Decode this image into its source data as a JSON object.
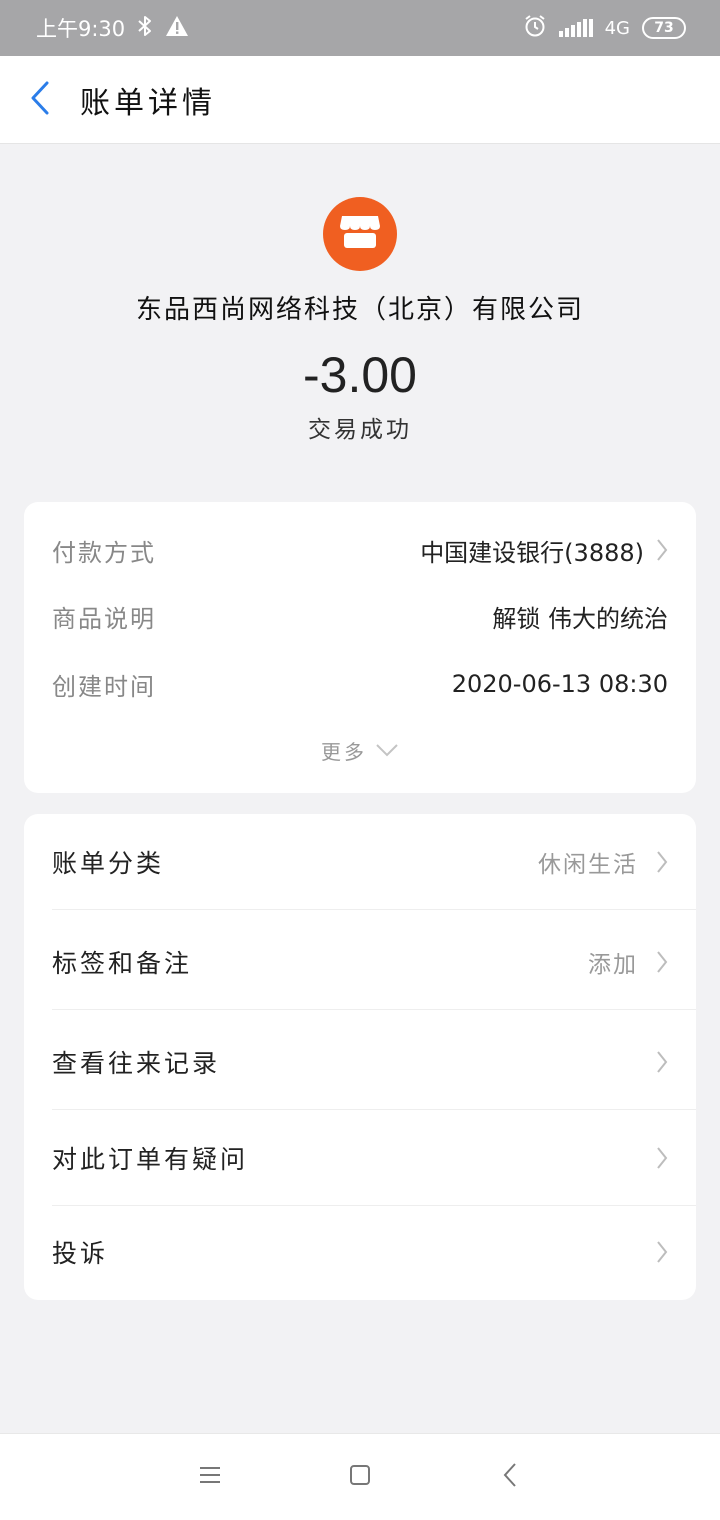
{
  "status_bar": {
    "time": "上午9:30",
    "network": "4G",
    "battery": "73",
    "icons": [
      "bluetooth-icon",
      "warning-icon",
      "alarm-icon",
      "signal-icon",
      "battery-icon"
    ]
  },
  "header": {
    "title": "账单详情",
    "back_icon": "chevron-left-icon",
    "accent_color": "#2b7de9"
  },
  "summary": {
    "merchant_name": "东品西尚网络科技（北京）有限公司",
    "amount": "-3.00",
    "status": "交易成功",
    "logo_icon": "shop-icon",
    "logo_color": "#f05f21"
  },
  "details": {
    "rows": [
      {
        "label": "付款方式",
        "value": "中国建设银行(3888)"
      },
      {
        "label": "商品说明",
        "value": "解锁 伟大的统治"
      },
      {
        "label": "创建时间",
        "value": "2020-06-13 08:30"
      }
    ],
    "more_label": "更多"
  },
  "menu": {
    "items": [
      {
        "label": "账单分类",
        "value": "休闲生活"
      },
      {
        "label": "标签和备注",
        "value": "添加"
      },
      {
        "label": "查看往来记录",
        "value": ""
      },
      {
        "label": "对此订单有疑问",
        "value": ""
      },
      {
        "label": "投诉",
        "value": ""
      }
    ]
  },
  "nav_bar": {
    "icons": [
      "menu-icon",
      "home-icon",
      "back-icon"
    ]
  }
}
